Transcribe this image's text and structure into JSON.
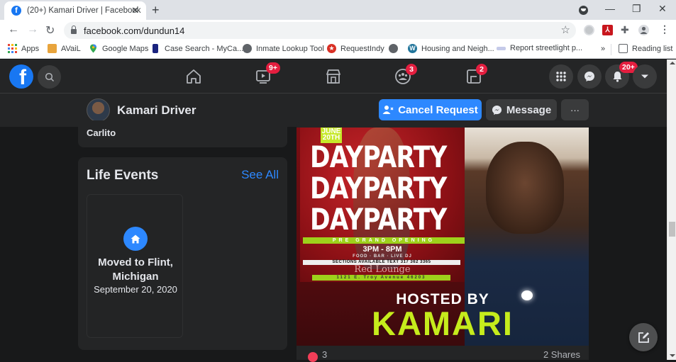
{
  "browser": {
    "tab_title": "(20+) Kamari Driver | Facebook",
    "tab_favicon": "facebook-icon",
    "new_tab": "+",
    "url": "facebook.com/dundun14",
    "window_controls": {
      "minimize": "—",
      "restore": "❐",
      "close": "✕"
    },
    "nav": {
      "back": "←",
      "forward": "→",
      "reload": "↻"
    },
    "extensions": [
      "extension-icon-grey",
      "adobe-acrobat-icon",
      "puzzle-extensions-icon",
      "profile-icon",
      "menu-icon"
    ],
    "bookmarks": [
      {
        "label": "Apps",
        "icon": "apps-grid-icon",
        "color": "#e94235"
      },
      {
        "label": "AVaiL",
        "icon": "folder-icon",
        "color": "#e8a43c"
      },
      {
        "label": "Google Maps",
        "icon": "map-pin-icon",
        "color": "#34a853"
      },
      {
        "label": "Case Search - MyCa...",
        "icon": "bookmark-icon",
        "color": "#1a237e"
      },
      {
        "label": "Inmate Lookup Tool",
        "icon": "globe-icon",
        "color": "#5f6368"
      },
      {
        "label": "RequestIndy",
        "icon": "star-badge-icon",
        "color": "#d93025"
      },
      {
        "label": "",
        "icon": "globe-icon",
        "color": "#5f6368"
      },
      {
        "label": "Housing and Neigh...",
        "icon": "wordpress-icon",
        "color": "#21759b"
      },
      {
        "label": "Report streetlight p...",
        "icon": "site-icon",
        "color": "#5c6bc0"
      }
    ],
    "more_bookmarks": "»",
    "reading_list": "Reading list"
  },
  "fb_nav": {
    "logo": "f",
    "badges": {
      "watch": "9+",
      "groups": "3",
      "gaming": "2",
      "notifications": "20+"
    }
  },
  "profile": {
    "name": "Kamari Driver",
    "cancel_request": "Cancel Request",
    "message": "Message",
    "more": "···"
  },
  "left": {
    "previous_card_text": "Carlito",
    "life_events": {
      "title": "Life Events",
      "see_all": "See All",
      "items": [
        {
          "name": "Moved to Flint, Michigan",
          "date": "September 20, 2020",
          "icon": "home-icon"
        }
      ]
    }
  },
  "post": {
    "flyer": {
      "date_line1": "JUNE",
      "date_line2": "20TH",
      "headline": [
        "DAYPARTY",
        "DAYPARTY",
        "DAYPARTY"
      ],
      "strip": "PRE GRAND OPENING",
      "times": "3PM - 8PM",
      "amenities": "FOOD · BAR · LIVE DJ",
      "sections": "SECTIONS AVAILABLE TEXT 317 362 3365",
      "venue": "Red Lounge",
      "address": "1121 E. Troy Avenue 46203"
    },
    "hosted_by": "HOSTED BY",
    "host": "KAMARI",
    "reactions_count": "3",
    "shares": "2 Shares"
  },
  "colors": {
    "fb_blue": "#2d88ff",
    "badge_red": "#e41e3f",
    "card_bg": "#242526",
    "page_bg": "#18191a",
    "flyer_green": "#c6ec1c"
  }
}
